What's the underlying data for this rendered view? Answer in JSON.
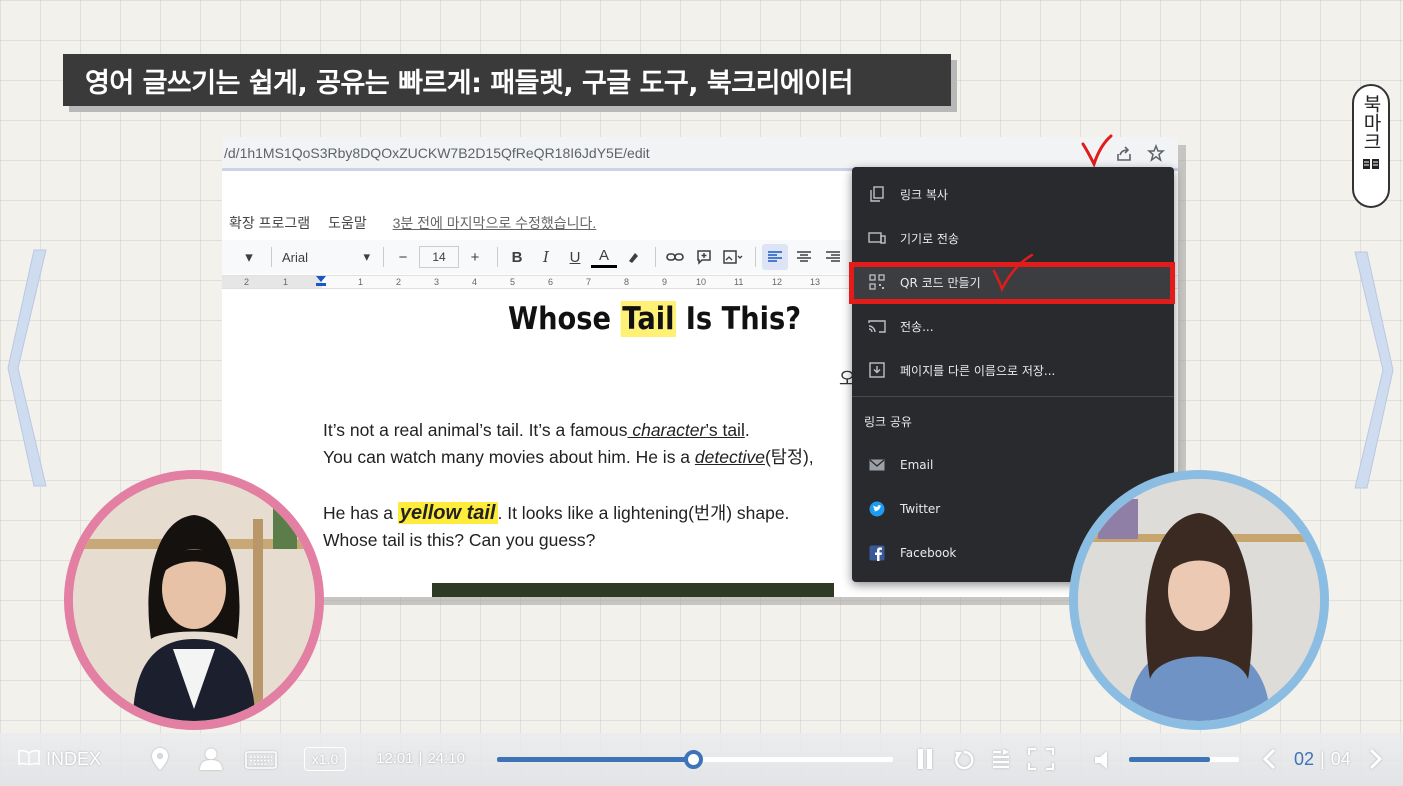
{
  "title": "영어 글쓰기는 쉽게, 공유는 빠르게: 패들렛, 구글 도구, 북크리에이터",
  "bookmark": "북마크",
  "browser": {
    "url": "/d/1h1MS1QoS3Rby8DQOxZUCKW7B2D15QfReQR18I6JdY5E/edit"
  },
  "docs": {
    "menu": [
      "확장 프로그램",
      "도움말"
    ],
    "last_edit": "3분 전에 마지막으로 수정했습니다.",
    "font": "Arial",
    "font_size": "14",
    "ruler_labels": [
      "2",
      "1",
      "1",
      "2",
      "3",
      "4",
      "5",
      "6",
      "7",
      "8",
      "9",
      "10",
      "11",
      "12",
      "13"
    ],
    "heading_pre": "Whose ",
    "heading_hl": "Tail",
    "heading_post": " Is This?",
    "corner_text": "오",
    "p1": {
      "l1a": "It’s not a real animal’s tail. It’s a famous",
      "l1b": " character",
      "l1c": "’s tail",
      "l1d": ".",
      "l2a": "You can watch many movies about him. He is a ",
      "l2b": "detective",
      "l2c": "(탐정),"
    },
    "p2": {
      "l1a": "He has a ",
      "l1b": "yellow tail",
      "l1c": ". It looks like a lightening(번개) shape.",
      "l2": "Whose tail is this? Can you guess?"
    }
  },
  "context_menu": {
    "items": [
      {
        "label": "링크 복사",
        "icon": "copy-icon"
      },
      {
        "label": "기기로 전송",
        "icon": "device-send-icon"
      },
      {
        "label": "QR 코드 만들기",
        "icon": "qr-code-icon"
      },
      {
        "label": "전송...",
        "icon": "cast-icon"
      },
      {
        "label": "페이지를 다른 이름으로 저장...",
        "icon": "save-page-icon"
      }
    ],
    "share_section": "링크 공유",
    "share_items": [
      {
        "label": "Email",
        "icon": "email-icon"
      },
      {
        "label": "Twitter",
        "icon": "twitter-icon"
      },
      {
        "label": "Facebook",
        "icon": "facebook-icon"
      }
    ]
  },
  "player": {
    "index_label": "INDEX",
    "speed": "x1.0",
    "current_time": "12:01",
    "total_time": "24:10",
    "progress": 0.497,
    "volume": 0.74,
    "page_current": "02",
    "page_total": "04",
    "accent_color": "#3f73b8"
  },
  "colors": {
    "highlight_box": "#e21b1b",
    "left_portrait_ring": "#e27fa2",
    "right_portrait_ring": "#8bbde3"
  }
}
